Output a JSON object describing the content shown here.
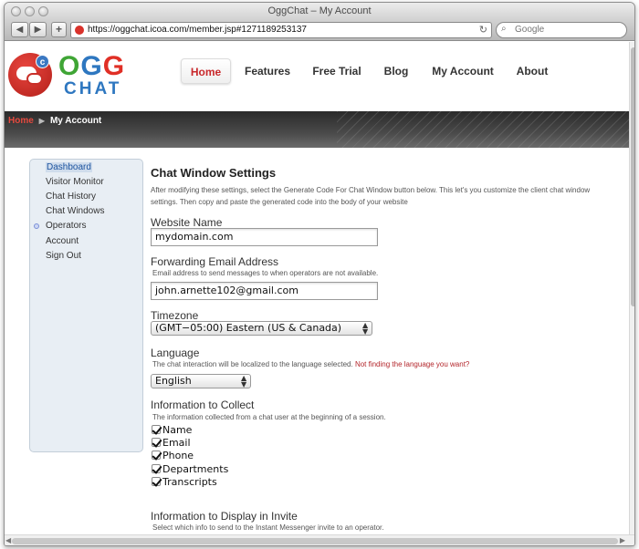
{
  "browser": {
    "window_title": "OggChat – My Account",
    "back_glyph": "◀",
    "forward_glyph": "▶",
    "add_glyph": "+",
    "url": "https://oggchat.icoa.com/member.jsp#1271189253137",
    "reload_glyph": "↻",
    "search_placeholder": "Google",
    "search_glyph": "⌕"
  },
  "logo": {
    "letter_o": "O",
    "letter_g1": "G",
    "letter_g2": "G",
    "chat": "CHAT",
    "badge": "c"
  },
  "nav": {
    "items": [
      {
        "label": "Home",
        "active": true
      },
      {
        "label": "Features"
      },
      {
        "label": "Free Trial"
      },
      {
        "label": "Blog"
      },
      {
        "label": "My Account"
      },
      {
        "label": "About"
      }
    ]
  },
  "breadcrumb": {
    "home": "Home",
    "sep": "▶",
    "current": "My Account"
  },
  "sidebar": {
    "items": [
      {
        "label": "Dashboard",
        "active": true
      },
      {
        "label": "Visitor Monitor"
      },
      {
        "label": "Chat History"
      },
      {
        "label": "Chat Windows"
      },
      {
        "label": "Operators",
        "bullet": true
      },
      {
        "label": "Account"
      },
      {
        "label": "Sign Out"
      }
    ]
  },
  "content": {
    "title": "Chat Window Settings",
    "intro": "After modifying these settings, select the Generate Code For Chat Window button below. This let's you customize the client chat window settings. Then copy and paste the generated code into the body of your website",
    "website_name": {
      "label": "Website Name",
      "value": "mydomain.com"
    },
    "forwarding_email": {
      "label": "Forwarding Email Address",
      "help": "Email address to send messages to when operators are not available.",
      "value": "john.arnette102@gmail.com"
    },
    "timezone": {
      "label": "Timezone",
      "value": "(GMT−05:00) Eastern (US & Canada)"
    },
    "language": {
      "label": "Language",
      "help": "The chat interaction will be localized to the language selected.",
      "help_link": "Not finding the language you want?",
      "value": "English"
    },
    "info_collect": {
      "label": "Information to Collect",
      "help": "The information collected from a chat user at the beginning of a session.",
      "options": [
        {
          "label": "Name",
          "checked": true
        },
        {
          "label": "Email",
          "checked": true
        },
        {
          "label": "Phone",
          "checked": true
        },
        {
          "label": "Departments",
          "checked": true
        },
        {
          "label": "Transcripts",
          "checked": true
        }
      ]
    },
    "info_invite": {
      "label": "Information to Display in Invite",
      "help": "Select which info to send to the Instant Messenger invite to an operator."
    }
  },
  "colors": {
    "accent_red": "#c8282b",
    "brand_blue": "#2e77c0",
    "brand_green": "#3fa535"
  }
}
